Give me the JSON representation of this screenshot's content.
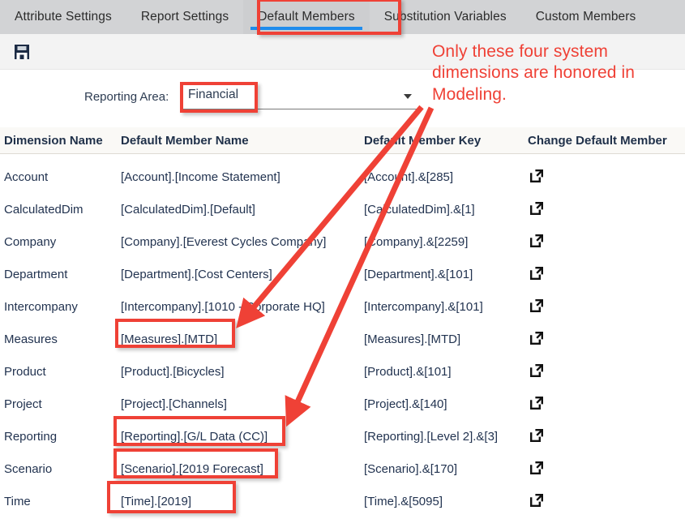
{
  "tabs": [
    {
      "label": "Attribute Settings",
      "active": false
    },
    {
      "label": "Report Settings",
      "active": false
    },
    {
      "label": "Default Members",
      "active": true
    },
    {
      "label": "Substitution Variables",
      "active": false
    },
    {
      "label": "Custom Members",
      "active": false
    }
  ],
  "toolbar": {
    "save_label": "Save",
    "save_icon": "floppy-disk-save-icon"
  },
  "filter": {
    "label": "Reporting Area:",
    "value": "Financial",
    "placeholder": "Reporting Area",
    "caret_icon": "chevron-down-icon"
  },
  "table": {
    "columns": [
      "Dimension Name",
      "Default Member Name",
      "Default Member Key",
      "Change Default Member"
    ],
    "action_icon": "external-link-icon",
    "rows": [
      {
        "dimension": "Account",
        "member_name": "[Account].[Income Statement]",
        "member_key": "[Account].&[285]",
        "highlighted": false
      },
      {
        "dimension": "CalculatedDim",
        "member_name": "[CalculatedDim].[Default]",
        "member_key": "[CalculatedDim].&[1]",
        "highlighted": false
      },
      {
        "dimension": "Company",
        "member_name": "[Company].[Everest Cycles Company]",
        "member_key": "[Company].&[2259]",
        "highlighted": false
      },
      {
        "dimension": "Department",
        "member_name": "[Department].[Cost Centers]",
        "member_key": "[Department].&[101]",
        "highlighted": false
      },
      {
        "dimension": "Intercompany",
        "member_name": "[Intercompany].[1010 - Corporate HQ]",
        "member_key": "[Intercompany].&[101]",
        "highlighted": false
      },
      {
        "dimension": "Measures",
        "member_name": "[Measures].[MTD]",
        "member_key": "[Measures].[MTD]",
        "highlighted": true
      },
      {
        "dimension": "Product",
        "member_name": "[Product].[Bicycles]",
        "member_key": "[Product].&[101]",
        "highlighted": false
      },
      {
        "dimension": "Project",
        "member_name": "[Project].[Channels]",
        "member_key": "[Project].&[140]",
        "highlighted": false
      },
      {
        "dimension": "Reporting",
        "member_name": "[Reporting].[G/L Data (CC)]",
        "member_key": "[Reporting].[Level 2].&[3]",
        "highlighted": true
      },
      {
        "dimension": "Scenario",
        "member_name": "[Scenario].[2019 Forecast]",
        "member_key": "[Scenario].&[170]",
        "highlighted": true
      },
      {
        "dimension": "Time",
        "member_name": "[Time].[2019]",
        "member_key": "[Time].&[5095]",
        "highlighted": true
      }
    ]
  },
  "annotation": {
    "text": "Only these four system dimensions are honored in Modeling.",
    "color": "#ef4136",
    "arrow_count": 2
  },
  "colors": {
    "tabbar_bg": "#d2d3d5",
    "active_tab_bg": "#cdced0",
    "active_tab_underline": "#1f8ced",
    "toolbar_bg": "#f3f3f3",
    "header_bg": "#faf9f6",
    "text": "#223350",
    "annotation_red": "#ef4136"
  }
}
